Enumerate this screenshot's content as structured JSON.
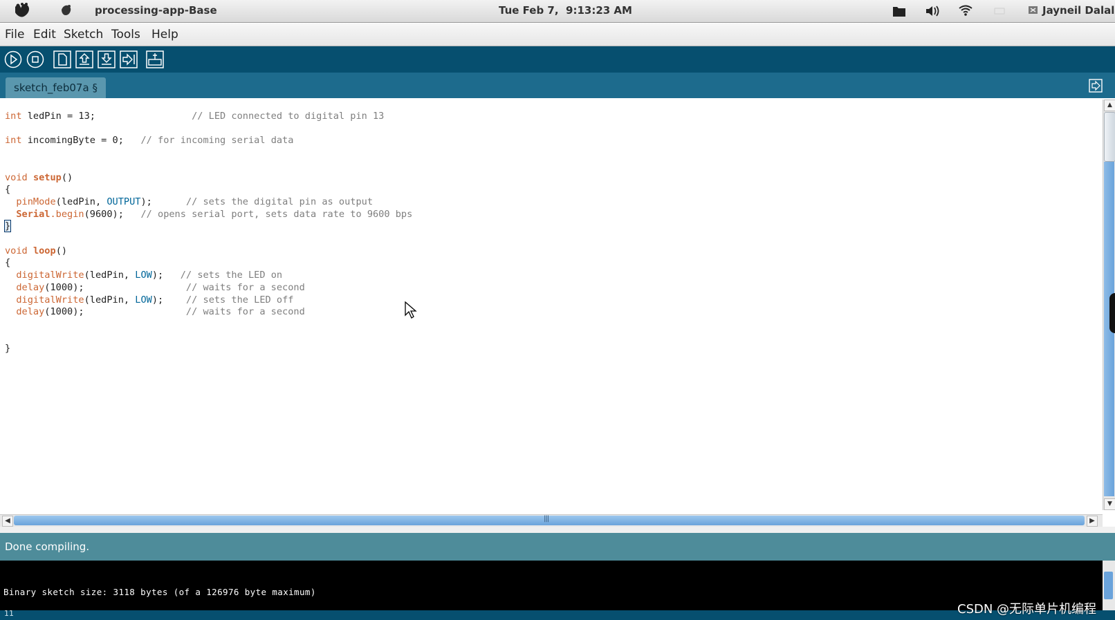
{
  "system_bar": {
    "app_title": "processing-app-Base",
    "clock": "Tue Feb 7,  9:13:23 AM",
    "user": "Jayneil Dalal",
    "icons": [
      "ubuntu-logo-icon",
      "gimp-icon",
      "folder-icon",
      "volume-icon",
      "wifi-icon",
      "battery-icon",
      "user-status-icon"
    ]
  },
  "menu": [
    "File",
    "Edit",
    "Sketch",
    "Tools",
    "Help"
  ],
  "toolbar": {
    "buttons": [
      "verify-icon",
      "stop-icon",
      "new-icon",
      "open-icon",
      "save-icon",
      "upload-icon",
      "serial-monitor-icon"
    ]
  },
  "tabs": [
    {
      "label": "sketch_feb07a §"
    }
  ],
  "status": {
    "message": "Done compiling."
  },
  "console": {
    "output": "Binary sketch size: 3118 bytes (of a 126976 byte maximum)"
  },
  "footer": {
    "line_number": "11"
  },
  "watermark": "CSDN @无际单片机编程",
  "colors": {
    "toolbar": "#064f6f",
    "tabstrip": "#1d6b8d",
    "status": "#4e8c9a",
    "keyword": "#cc6633",
    "constant": "#006699",
    "comment": "#7e7e7e"
  },
  "code": {
    "line1_type": "int",
    "line1_rest": " ledPin = 13;",
    "line1_comment": "// LED connected to digital pin 13",
    "line2_type": "int",
    "line2_rest": " incomingByte = 0;",
    "line2_comment": "// for incoming serial data",
    "setup_void": "void",
    "setup_name": "setup",
    "setup_parens": "()",
    "open_brace": "{",
    "pinmode_fn": "pinMode",
    "pinmode_args1": "(ledPin, ",
    "pinmode_const": "OUTPUT",
    "pinmode_args2": ");",
    "pinmode_comment": "// sets the digital pin as output",
    "serial_obj": "Serial",
    "serial_fn": ".begin",
    "serial_args": "(9600);",
    "serial_comment": "// opens serial port, sets data rate to 9600 bps",
    "close_brace": "}",
    "loop_void": "void",
    "loop_name": "loop",
    "loop_parens": "()",
    "dw1_fn": "digitalWrite",
    "dw1_args1": "(ledPin, ",
    "dw1_const": "LOW",
    "dw1_args2": ");",
    "dw1_comment": "// sets the LED on",
    "delay1_fn": "delay",
    "delay1_args": "(1000);",
    "delay1_comment": "// waits for a second",
    "dw2_fn": "digitalWrite",
    "dw2_args1": "(ledPin, ",
    "dw2_const": "LOW",
    "dw2_args2": ");",
    "dw2_comment": "// sets the LED off",
    "delay2_fn": "delay",
    "delay2_args": "(1000);",
    "delay2_comment": "// waits for a second"
  }
}
